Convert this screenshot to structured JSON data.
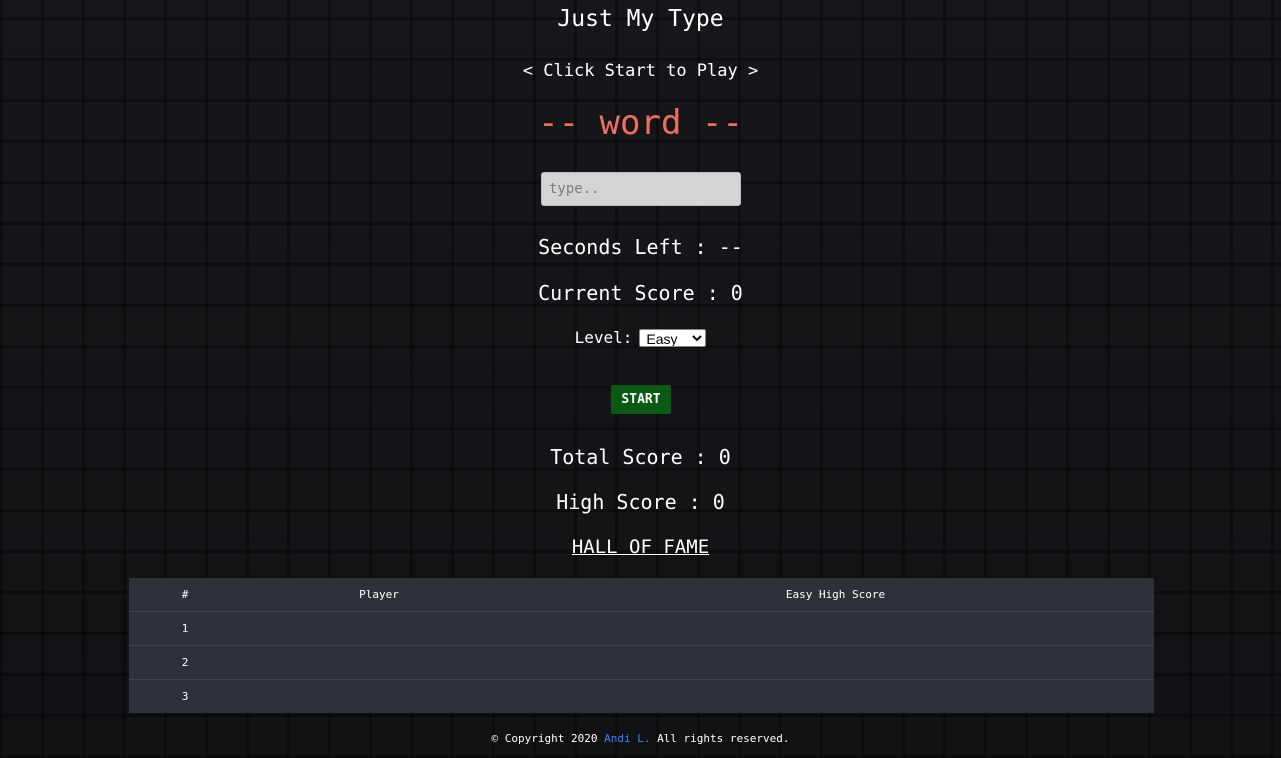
{
  "header": {
    "title": "Just My Type",
    "subtitle": "< Click Start to Play >",
    "word": "-- word --"
  },
  "input": {
    "placeholder": "type..",
    "value": ""
  },
  "stats": {
    "seconds_left": "Seconds Left : --",
    "current_score": "Current Score : 0",
    "total_score": "Total Score : 0",
    "high_score": "High Score : 0"
  },
  "level": {
    "label": "Level:",
    "selected": "Easy"
  },
  "start_button": "START",
  "hall_of_fame": {
    "title": "HALL OF FAME",
    "columns": [
      "#",
      "Player",
      "Easy High Score"
    ],
    "rows": [
      {
        "rank": "1",
        "player": "",
        "score": ""
      },
      {
        "rank": "2",
        "player": "",
        "score": ""
      },
      {
        "rank": "3",
        "player": "",
        "score": ""
      }
    ]
  },
  "footer": {
    "prefix": "© Copyright 2020",
    "author": "Andi L.",
    "suffix": "All rights reserved."
  },
  "colors": {
    "word": "#ee6e61",
    "start_button": "#0b5a14",
    "link": "#3a86ff",
    "table_bg": "#2e3238"
  }
}
